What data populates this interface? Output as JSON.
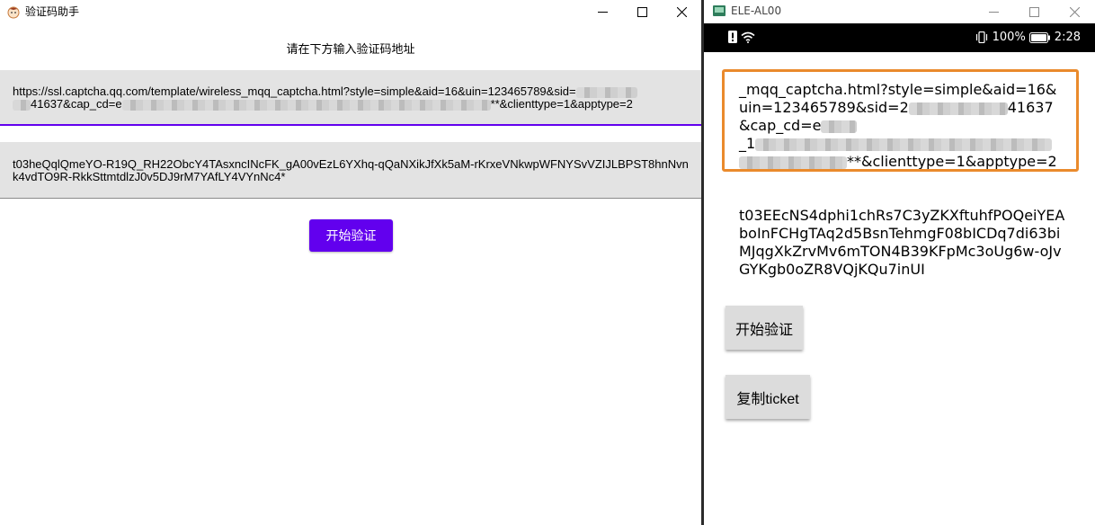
{
  "left_window": {
    "title": "验证码助手",
    "prompt": "请在下方输入验证码地址",
    "url_field": {
      "part1": "https://ssl.captcha.qq.com/template/wireless_mqq_captcha.html?style=simple&aid=16&uin=123465789&sid=",
      "part2": "41637&cap_cd=e",
      "part3": "**&clienttype=1&apptype=2"
    },
    "ticket_field": {
      "value": "t03heQqlQmeYO-R19Q_RH22ObcY4TAsxncINcFK_gA00vEzL6YXhq-qQaNXikJfXk5aM-rKrxeVNkwpWFNYSvVZIJLBPST8hnNvnk4vdTO9R-RkkSttmtdlzJ0v5DJ9rM7YAfLY4VYnNc4*"
    },
    "verify_button": "开始验证"
  },
  "right_window": {
    "title": "ELE-AL00",
    "status": {
      "battery": "100%",
      "time": "2:28"
    },
    "url_field": {
      "line1": "_mqq_captcha.html?style=simple&aid=16&uin=123465789&sid=2",
      "line1b": "41637&cap_cd=e",
      "line2_prefix": "_1",
      "line2_end": "**&clienttype=1&apptype=2"
    },
    "ticket": "t03EEcNS4dphi1chRs7C3yZKXftuhfPOQeiYEAboInFCHgTAq2d5BsnTehmgF08bICDq7di63biMJqgXkZrvMv6mTON4B39KFpMc3oUg6w-oJvGYKgb0oZR8VQjKQu7inUI",
    "verify_button": "开始验证",
    "copy_button": "复制ticket"
  },
  "colors": {
    "accent": "#6200ee",
    "input_focus": "#ea8a2c",
    "status_bar": "#000000"
  },
  "icons": [
    "app-icon",
    "minimize-icon",
    "maximize-icon",
    "close-icon",
    "alert-icon",
    "wifi-icon",
    "vibrate-icon",
    "battery-icon"
  ]
}
